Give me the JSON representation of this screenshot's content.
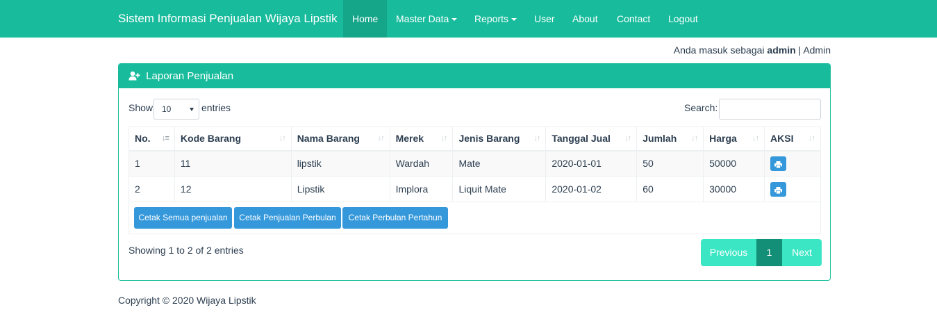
{
  "navbar": {
    "brand": "Sistem Informasi Penjualan Wijaya Lipstik",
    "items": [
      {
        "label": "Home",
        "active": true
      },
      {
        "label": "Master Data",
        "dropdown": true
      },
      {
        "label": "Reports",
        "dropdown": true
      },
      {
        "label": "User"
      },
      {
        "label": "About"
      },
      {
        "label": "Contact"
      },
      {
        "label": "Logout"
      }
    ],
    "color": "#18bc9c"
  },
  "login": {
    "prefix": "Anda masuk sebagai",
    "username": "admin",
    "separator": "|",
    "role": "Admin"
  },
  "panel": {
    "icon": "user-plus-icon",
    "title": "Laporan Penjualan"
  },
  "table_controls": {
    "show_label": "Show",
    "page_length": "10",
    "entries_label": "entries",
    "search_label": "Search:",
    "search_value": ""
  },
  "table": {
    "headers": [
      "No.",
      "Kode Barang",
      "Nama Barang",
      "Merek",
      "Jenis Barang",
      "Tanggal Jual",
      "Jumlah",
      "Harga",
      "AKSI"
    ],
    "rows": [
      [
        "1",
        "11",
        "lipstik",
        "Wardah",
        "Mate",
        "2020-01-01",
        "50",
        "50000"
      ],
      [
        "2",
        "12",
        "Lipstik",
        "Implora",
        "Liquit Mate",
        "2020-01-02",
        "60",
        "30000"
      ]
    ],
    "row_action_icon": "print-icon"
  },
  "buttons": {
    "print_all": "Cetak Semua penjualan",
    "print_monthly": "Cetak Penjualan Perbulan",
    "print_yearly": "Cetak Perbulan Pertahun"
  },
  "pagination": {
    "info": "Showing 1 to 2 of 2 entries",
    "previous": "Previous",
    "current": "1",
    "next": "Next"
  },
  "footer": {
    "copyright": "Copyright © 2020 Wijaya Lipstik"
  }
}
